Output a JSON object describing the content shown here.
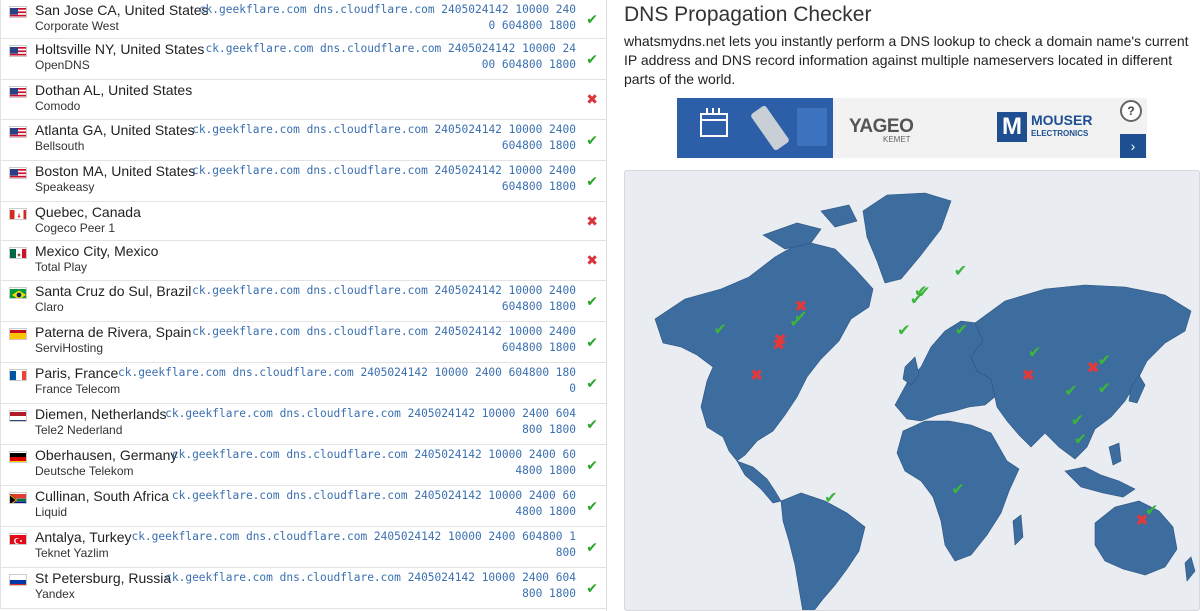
{
  "header": {
    "title": "DNS Propagation Checker",
    "description": "whatsmydns.net lets you instantly perform a DNS lookup to check a domain name's current IP address and DNS record information against multiple nameservers located in different parts of the world."
  },
  "ad": {
    "brand1": "YAGEO",
    "brand1_sub": "KEMET",
    "brand2_mark": "M",
    "brand2": "MOUSER",
    "brand2_sub": "ELECTRONICS",
    "info_icon": "?",
    "arrow_icon": "›"
  },
  "colors": {
    "ok": "#2aa52a",
    "bad": "#d9333b",
    "land": "#3d6c9e",
    "link": "#3a6fb0"
  },
  "results": [
    {
      "flag": "us",
      "location": "San Jose CA, United States",
      "provider": "Corporate West",
      "record_line1": "ck.geekflare.com dns.cloudflare.com 2405024142 10000 240",
      "record_line2": "0 604800 1800",
      "status": "✔",
      "ok": true
    },
    {
      "flag": "us",
      "location": "Holtsville NY, United States",
      "provider": "OpenDNS",
      "record_line1": "ck.geekflare.com dns.cloudflare.com 2405024142 10000 24",
      "record_line2": "00 604800 1800",
      "status": "✔",
      "ok": true
    },
    {
      "flag": "us",
      "location": "Dothan AL, United States",
      "provider": "Comodo",
      "record_line1": "",
      "record_line2": "",
      "status": "✖",
      "ok": false
    },
    {
      "flag": "us",
      "location": "Atlanta GA, United States",
      "provider": "Bellsouth",
      "record_line1": "ck.geekflare.com dns.cloudflare.com 2405024142 10000 2400",
      "record_line2": "604800 1800",
      "status": "✔",
      "ok": true
    },
    {
      "flag": "us",
      "location": "Boston MA, United States",
      "provider": "Speakeasy",
      "record_line1": "ck.geekflare.com dns.cloudflare.com 2405024142 10000 2400",
      "record_line2": "604800 1800",
      "status": "✔",
      "ok": true
    },
    {
      "flag": "ca",
      "location": "Quebec, Canada",
      "provider": "Cogeco Peer 1",
      "record_line1": "",
      "record_line2": "",
      "status": "✖",
      "ok": false
    },
    {
      "flag": "mx",
      "location": "Mexico City, Mexico",
      "provider": "Total Play",
      "record_line1": "",
      "record_line2": "",
      "status": "✖",
      "ok": false
    },
    {
      "flag": "br",
      "location": "Santa Cruz do Sul, Brazil",
      "provider": "Claro",
      "record_line1": "ck.geekflare.com dns.cloudflare.com 2405024142 10000 2400",
      "record_line2": "604800 1800",
      "status": "✔",
      "ok": true
    },
    {
      "flag": "es",
      "location": "Paterna de Rivera, Spain",
      "provider": "ServiHosting",
      "record_line1": "ck.geekflare.com dns.cloudflare.com 2405024142 10000 2400",
      "record_line2": "604800 1800",
      "status": "✔",
      "ok": true
    },
    {
      "flag": "fr",
      "location": "Paris, France",
      "provider": "France Telecom",
      "record_line1": "ck.geekflare.com dns.cloudflare.com 2405024142 10000 2400 604800 180",
      "record_line2": "0",
      "status": "✔",
      "ok": true
    },
    {
      "flag": "nl",
      "location": "Diemen, Netherlands",
      "provider": "Tele2 Nederland",
      "record_line1": "ck.geekflare.com dns.cloudflare.com 2405024142 10000 2400 604",
      "record_line2": "800 1800",
      "status": "✔",
      "ok": true
    },
    {
      "flag": "de",
      "location": "Oberhausen, Germany",
      "provider": "Deutsche Telekom",
      "record_line1": "ck.geekflare.com dns.cloudflare.com 2405024142 10000 2400 60",
      "record_line2": "4800 1800",
      "status": "✔",
      "ok": true
    },
    {
      "flag": "za",
      "location": "Cullinan, South Africa",
      "provider": "Liquid",
      "record_line1": "ck.geekflare.com dns.cloudflare.com 2405024142 10000 2400 60",
      "record_line2": "4800 1800",
      "status": "✔",
      "ok": true
    },
    {
      "flag": "tr",
      "location": "Antalya, Turkey",
      "provider": "Teknet Yazlim",
      "record_line1": "ck.geekflare.com dns.cloudflare.com 2405024142 10000 2400 604800 1",
      "record_line2": "800",
      "status": "✔",
      "ok": true
    },
    {
      "flag": "ru",
      "location": "St Petersburg, Russia",
      "provider": "Yandex",
      "record_line1": "ck.geekflare.com dns.cloudflare.com 2405024142 10000 2400 604",
      "record_line2": "800 1800",
      "status": "✔",
      "ok": true
    }
  ],
  "map": {
    "markers": [
      {
        "lon": -122,
        "lat": 37,
        "ok": true
      },
      {
        "lon": -99,
        "lat": 19,
        "ok": false
      },
      {
        "lon": -71,
        "lat": 46,
        "ok": false
      },
      {
        "lon": -71,
        "lat": 42,
        "ok": true
      },
      {
        "lon": -84,
        "lat": 33,
        "ok": false
      },
      {
        "lon": -85,
        "lat": 31,
        "ok": false
      },
      {
        "lon": -74,
        "lat": 40,
        "ok": true
      },
      {
        "lon": -52,
        "lat": -29,
        "ok": true
      },
      {
        "lon": 4.9,
        "lat": 52,
        "ok": true
      },
      {
        "lon": 2.3,
        "lat": 48.8,
        "ok": true
      },
      {
        "lon": 6.8,
        "lat": 51.5,
        "ok": true
      },
      {
        "lon": -5.8,
        "lat": 36.6,
        "ok": true
      },
      {
        "lon": 30,
        "lat": 60,
        "ok": true
      },
      {
        "lon": 30.7,
        "lat": 36.9,
        "ok": true
      },
      {
        "lon": 28.4,
        "lat": -25.7,
        "ok": true
      },
      {
        "lon": 77,
        "lat": 28,
        "ok": true
      },
      {
        "lon": 73,
        "lat": 19,
        "ok": false
      },
      {
        "lon": 100,
        "lat": 13,
        "ok": true
      },
      {
        "lon": 104,
        "lat": 1.3,
        "ok": true
      },
      {
        "lon": 106,
        "lat": -6,
        "ok": true
      },
      {
        "lon": 114,
        "lat": 22,
        "ok": false
      },
      {
        "lon": 121,
        "lat": 25,
        "ok": true
      },
      {
        "lon": 121,
        "lat": 14,
        "ok": true
      },
      {
        "lon": 151,
        "lat": -34,
        "ok": true
      },
      {
        "lon": 145,
        "lat": -37.8,
        "ok": false
      }
    ]
  }
}
